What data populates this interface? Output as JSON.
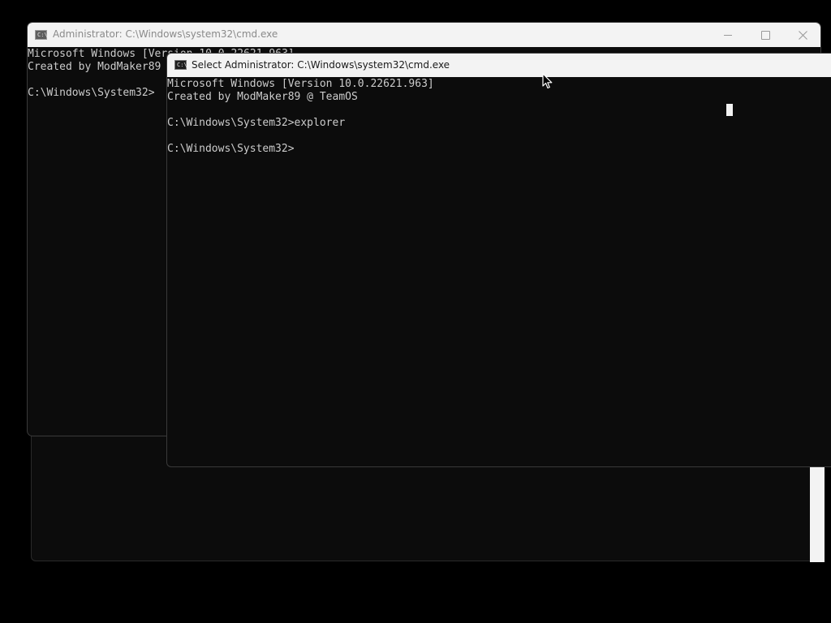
{
  "back_window": {
    "title": "Administrator: C:\\Windows\\system32\\cmd.exe",
    "icon_label": "C:\\",
    "lines": [
      "Microsoft Windows [Version 10.0.22621.963]",
      "Created by ModMaker89",
      "",
      "C:\\Windows\\System32>"
    ]
  },
  "front_window": {
    "title": "Select Administrator: C:\\Windows\\system32\\cmd.exe",
    "icon_label": "C:\\",
    "lines": [
      "Microsoft Windows [Version 10.0.22621.963]",
      "Created by ModMaker89 @ TeamOS",
      "",
      "C:\\Windows\\System32>explorer",
      "",
      "C:\\Windows\\System32>"
    ]
  },
  "colors": {
    "desktop": "#000000",
    "console_bg": "#0c0c0c",
    "console_text": "#cccccc",
    "titlebar_bg": "#f3f3f3"
  },
  "icons": {
    "app": "terminal-icon",
    "minimize": "minimize-icon",
    "maximize": "maximize-icon",
    "close": "close-icon",
    "pointer": "mouse-pointer-icon"
  }
}
